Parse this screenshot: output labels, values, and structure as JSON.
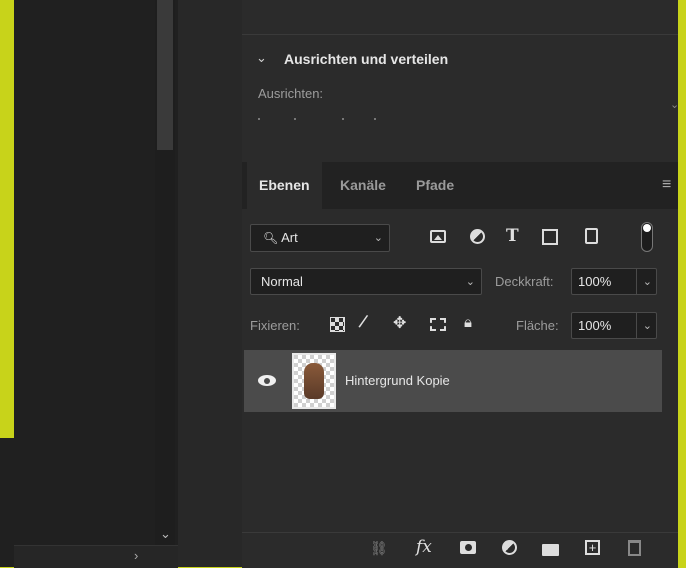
{
  "align_panel": {
    "title": "Ausrichten und verteilen",
    "align_label": "Ausrichten:"
  },
  "tabs": [
    {
      "label": "Ebenen",
      "active": true
    },
    {
      "label": "Kanäle",
      "active": false
    },
    {
      "label": "Pfade",
      "active": false
    }
  ],
  "filter": {
    "kind_value": "Art",
    "icons": [
      "image-filter-icon",
      "adjustment-filter-icon",
      "type-filter-icon",
      "shape-filter-icon",
      "smart-object-filter-icon",
      "filter-toggle-icon"
    ]
  },
  "blend": {
    "mode_value": "Normal",
    "opacity_label": "Deckkraft:",
    "opacity_value": "100%"
  },
  "lock": {
    "label": "Fixieren:",
    "fill_label": "Fläche:",
    "fill_value": "100%"
  },
  "layers": [
    {
      "name": "Hintergrund Kopie",
      "visible": true,
      "selected": true
    }
  ],
  "bottom_toolbar": {
    "icons": [
      "link-icon",
      "fx-icon",
      "mask-icon",
      "adjustment-layer-icon",
      "folder-icon",
      "new-layer-icon",
      "trash-icon"
    ],
    "fx_label": "fx"
  },
  "colors": {
    "accent_frame": "#c8d31a",
    "panel_bg": "#2b2b2b",
    "selected_row": "#4b4b4b"
  }
}
